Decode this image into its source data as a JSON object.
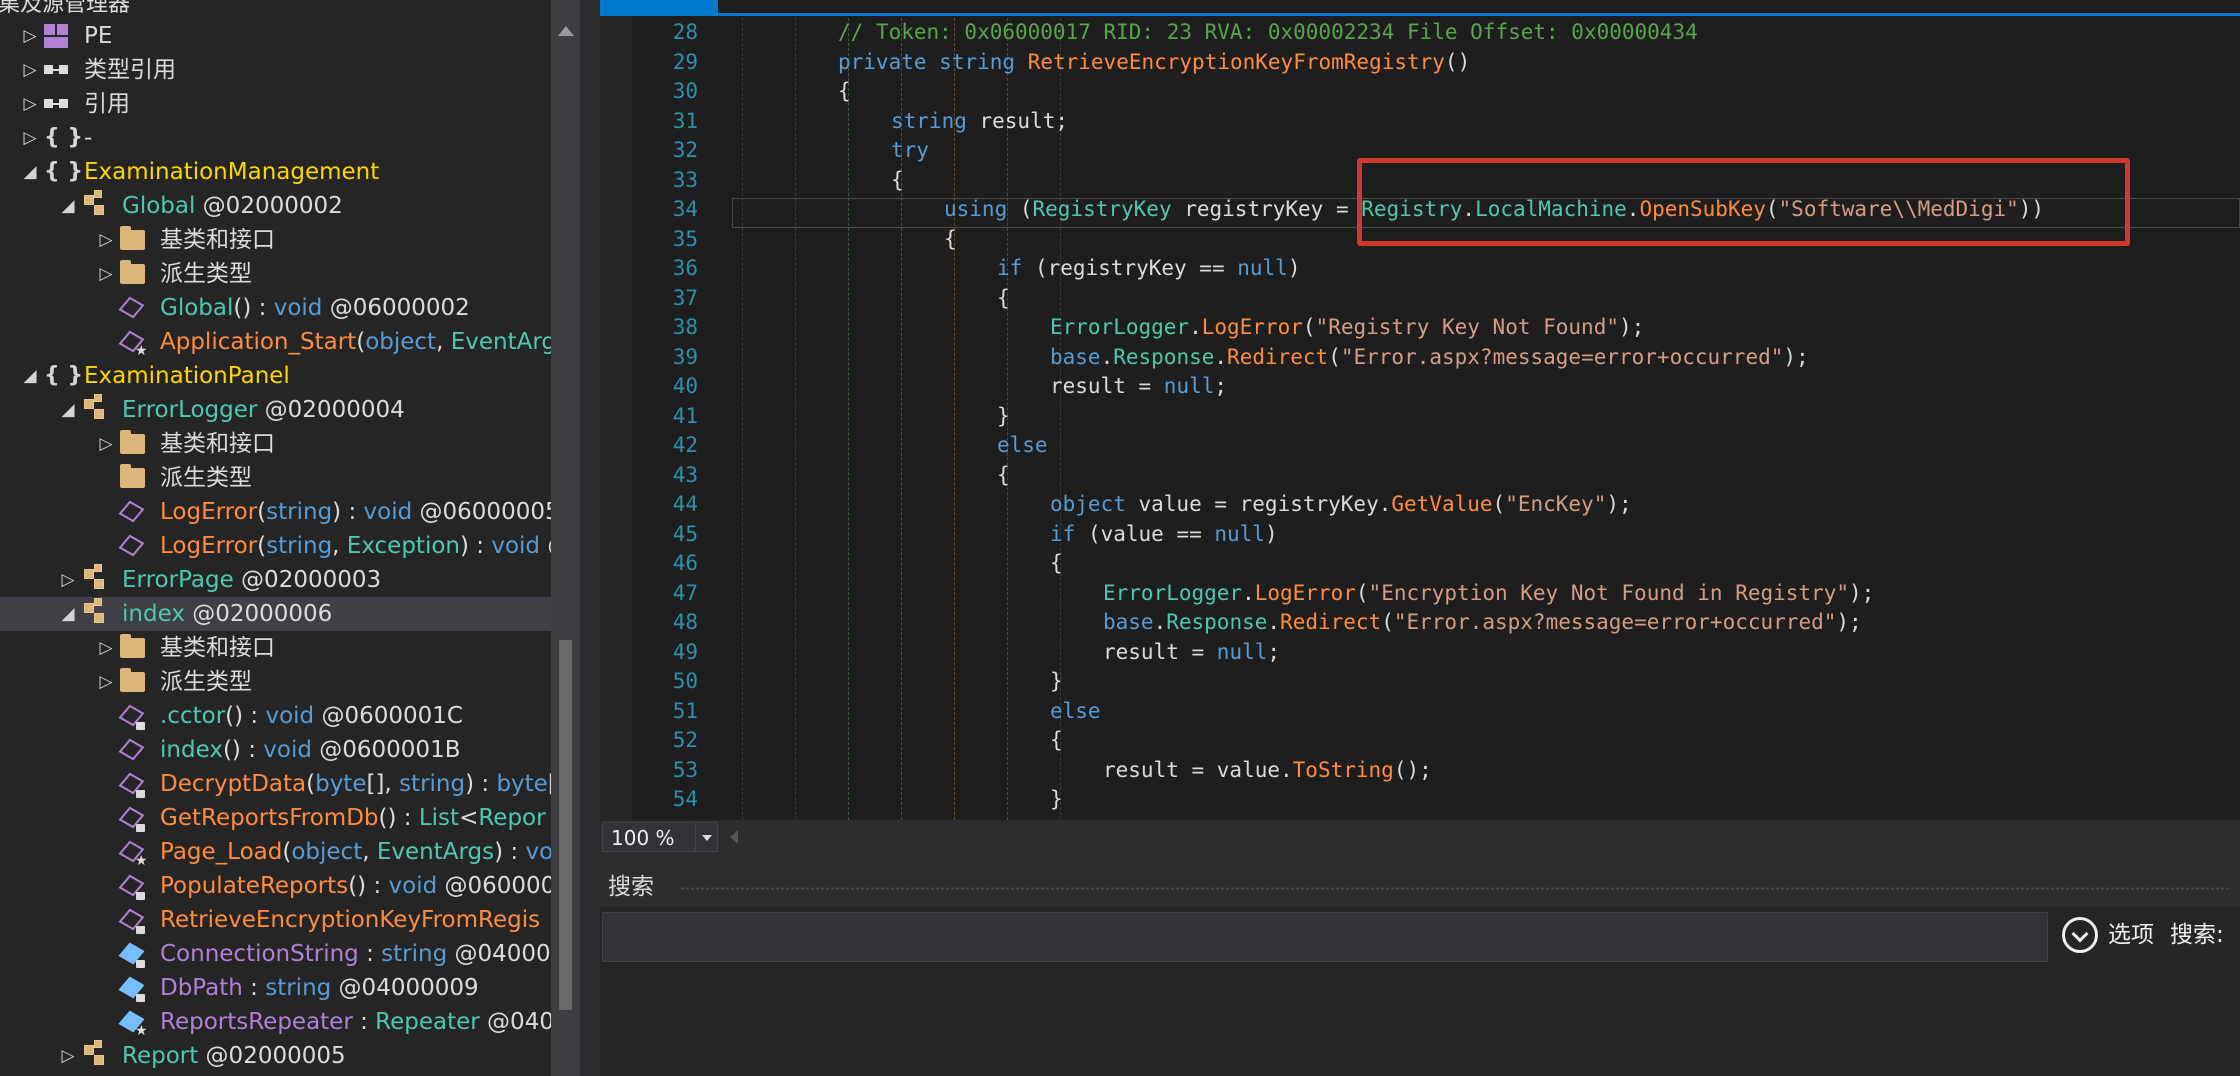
{
  "tree": {
    "title": "集及源管理器",
    "items": [
      {
        "type": "pe",
        "expander": "collapsed",
        "parts": [
          {
            "t": "PE",
            "c": "#dcdcdc"
          }
        ]
      },
      {
        "type": "ref",
        "expander": "collapsed",
        "parts": [
          {
            "t": "类型引用",
            "c": "#dcdcdc"
          }
        ]
      },
      {
        "type": "ref",
        "expander": "collapsed",
        "parts": [
          {
            "t": "引用",
            "c": "#dcdcdc"
          }
        ]
      },
      {
        "type": "ns",
        "expander": "collapsed",
        "parts": [
          {
            "t": "-",
            "c": "#dcdcdc"
          }
        ]
      },
      {
        "type": "ns",
        "expander": "expanded",
        "parts": [
          {
            "t": "ExaminationManagement",
            "c": "#ffd700"
          }
        ]
      },
      {
        "type": "class",
        "expander": "expanded",
        "parts": [
          {
            "t": "Global",
            "c": "#4ec9b0"
          },
          {
            "t": " @02000002",
            "c": "#dcdcdc"
          }
        ]
      },
      {
        "type": "folder",
        "expander": "collapsed",
        "parts": [
          {
            "t": "基类和接口",
            "c": "#dcdcdc"
          }
        ]
      },
      {
        "type": "folder",
        "expander": "collapsed",
        "parts": [
          {
            "t": "派生类型",
            "c": "#dcdcdc"
          }
        ]
      },
      {
        "type": "method",
        "expander": "none",
        "parts": [
          {
            "t": "Global",
            "c": "#4ec9b0"
          },
          {
            "t": "() : ",
            "c": "#dcdcdc"
          },
          {
            "t": "void",
            "c": "#569cd6"
          },
          {
            "t": " @06000002",
            "c": "#dcdcdc"
          }
        ]
      },
      {
        "type": "method-star",
        "expander": "none",
        "parts": [
          {
            "t": "Application_Start",
            "c": "#ff8c3f"
          },
          {
            "t": "(",
            "c": "#dcdcdc"
          },
          {
            "t": "object",
            "c": "#569cd6"
          },
          {
            "t": ", ",
            "c": "#dcdcdc"
          },
          {
            "t": "EventArgs",
            "c": "#4ec9b0"
          }
        ]
      },
      {
        "type": "ns",
        "expander": "expanded",
        "parts": [
          {
            "t": "ExaminationPanel",
            "c": "#ffd700"
          }
        ]
      },
      {
        "type": "class",
        "expander": "expanded",
        "parts": [
          {
            "t": "ErrorLogger",
            "c": "#4ec9b0"
          },
          {
            "t": " @02000004",
            "c": "#dcdcdc"
          }
        ]
      },
      {
        "type": "folder",
        "expander": "collapsed",
        "parts": [
          {
            "t": "基类和接口",
            "c": "#dcdcdc"
          }
        ]
      },
      {
        "type": "folder",
        "expander": "none",
        "parts": [
          {
            "t": "派生类型",
            "c": "#dcdcdc"
          }
        ]
      },
      {
        "type": "method",
        "expander": "none",
        "parts": [
          {
            "t": "LogError",
            "c": "#ff8c3f"
          },
          {
            "t": "(",
            "c": "#dcdcdc"
          },
          {
            "t": "string",
            "c": "#569cd6"
          },
          {
            "t": ") : ",
            "c": "#dcdcdc"
          },
          {
            "t": "void",
            "c": "#569cd6"
          },
          {
            "t": " @06000005",
            "c": "#dcdcdc"
          }
        ]
      },
      {
        "type": "method",
        "expander": "none",
        "parts": [
          {
            "t": "LogError",
            "c": "#ff8c3f"
          },
          {
            "t": "(",
            "c": "#dcdcdc"
          },
          {
            "t": "string",
            "c": "#569cd6"
          },
          {
            "t": ", ",
            "c": "#dcdcdc"
          },
          {
            "t": "Exception",
            "c": "#4ec9b0"
          },
          {
            "t": ") : ",
            "c": "#dcdcdc"
          },
          {
            "t": "void",
            "c": "#569cd6"
          },
          {
            "t": " @",
            "c": "#dcdcdc"
          }
        ]
      },
      {
        "type": "class",
        "expander": "collapsed",
        "parts": [
          {
            "t": "ErrorPage",
            "c": "#4ec9b0"
          },
          {
            "t": " @02000003",
            "c": "#dcdcdc"
          }
        ]
      },
      {
        "type": "class",
        "expander": "expanded",
        "selected": true,
        "parts": [
          {
            "t": "index",
            "c": "#4ec9b0"
          },
          {
            "t": " @02000006",
            "c": "#dcdcdc"
          }
        ]
      },
      {
        "type": "folder",
        "expander": "collapsed",
        "parts": [
          {
            "t": "基类和接口",
            "c": "#dcdcdc"
          }
        ]
      },
      {
        "type": "folder",
        "expander": "collapsed",
        "parts": [
          {
            "t": "派生类型",
            "c": "#dcdcdc"
          }
        ]
      },
      {
        "type": "method-lock",
        "expander": "none",
        "parts": [
          {
            "t": ".cctor",
            "c": "#4ec9b0"
          },
          {
            "t": "() : ",
            "c": "#dcdcdc"
          },
          {
            "t": "void",
            "c": "#569cd6"
          },
          {
            "t": " @0600001C",
            "c": "#dcdcdc"
          }
        ]
      },
      {
        "type": "method",
        "expander": "none",
        "parts": [
          {
            "t": "index",
            "c": "#4ec9b0"
          },
          {
            "t": "() : ",
            "c": "#dcdcdc"
          },
          {
            "t": "void",
            "c": "#569cd6"
          },
          {
            "t": " @0600001B",
            "c": "#dcdcdc"
          }
        ]
      },
      {
        "type": "method-lock",
        "expander": "none",
        "parts": [
          {
            "t": "DecryptData",
            "c": "#ff8c3f"
          },
          {
            "t": "(",
            "c": "#dcdcdc"
          },
          {
            "t": "byte",
            "c": "#569cd6"
          },
          {
            "t": "[], ",
            "c": "#dcdcdc"
          },
          {
            "t": "string",
            "c": "#569cd6"
          },
          {
            "t": ") : ",
            "c": "#dcdcdc"
          },
          {
            "t": "byte",
            "c": "#569cd6"
          },
          {
            "t": "[",
            "c": "#dcdcdc"
          }
        ]
      },
      {
        "type": "method-lock",
        "expander": "none",
        "parts": [
          {
            "t": "GetReportsFromDb",
            "c": "#ff8c3f"
          },
          {
            "t": "() : ",
            "c": "#dcdcdc"
          },
          {
            "t": "List",
            "c": "#4ec9b0"
          },
          {
            "t": "<",
            "c": "#dcdcdc"
          },
          {
            "t": "Repor",
            "c": "#4ec9b0"
          }
        ]
      },
      {
        "type": "method-star",
        "expander": "none",
        "parts": [
          {
            "t": "Page_Load",
            "c": "#ff8c3f"
          },
          {
            "t": "(",
            "c": "#dcdcdc"
          },
          {
            "t": "object",
            "c": "#569cd6"
          },
          {
            "t": ", ",
            "c": "#dcdcdc"
          },
          {
            "t": "EventArgs",
            "c": "#4ec9b0"
          },
          {
            "t": ") : ",
            "c": "#dcdcdc"
          },
          {
            "t": "vo",
            "c": "#569cd6"
          }
        ]
      },
      {
        "type": "method-lock",
        "expander": "none",
        "parts": [
          {
            "t": "PopulateReports",
            "c": "#ff8c3f"
          },
          {
            "t": "() : ",
            "c": "#dcdcdc"
          },
          {
            "t": "void",
            "c": "#569cd6"
          },
          {
            "t": " @060000",
            "c": "#dcdcdc"
          }
        ]
      },
      {
        "type": "method-lock",
        "expander": "none",
        "parts": [
          {
            "t": "RetrieveEncryptionKeyFromRegis",
            "c": "#ff8c3f"
          }
        ]
      },
      {
        "type": "field-lock",
        "expander": "none",
        "parts": [
          {
            "t": "ConnectionString",
            "c": "#b180d7"
          },
          {
            "t": " : ",
            "c": "#dcdcdc"
          },
          {
            "t": "string",
            "c": "#569cd6"
          },
          {
            "t": " @04000",
            "c": "#dcdcdc"
          }
        ]
      },
      {
        "type": "field-lock",
        "expander": "none",
        "parts": [
          {
            "t": "DbPath",
            "c": "#b180d7"
          },
          {
            "t": " : ",
            "c": "#dcdcdc"
          },
          {
            "t": "string",
            "c": "#569cd6"
          },
          {
            "t": " @04000009",
            "c": "#dcdcdc"
          }
        ]
      },
      {
        "type": "field-star",
        "expander": "none",
        "parts": [
          {
            "t": "ReportsRepeater",
            "c": "#b180d7"
          },
          {
            "t": " : ",
            "c": "#dcdcdc"
          },
          {
            "t": "Repeater",
            "c": "#4ec9b0"
          },
          {
            "t": " @040",
            "c": "#dcdcdc"
          }
        ]
      },
      {
        "type": "class",
        "expander": "collapsed",
        "parts": [
          {
            "t": "Report",
            "c": "#4ec9b0"
          },
          {
            "t": " @02000005",
            "c": "#dcdcdc"
          }
        ]
      }
    ]
  },
  "code": {
    "lines": [
      {
        "n": "28",
        "t": [
          [
            "cm",
            "// Token: 0x06000017 RID: 23 RVA: 0x00002234 File Offset: 0x00000434"
          ]
        ],
        "ind": 4
      },
      {
        "n": "29",
        "t": [
          [
            "kw",
            "private"
          ],
          [
            "pl",
            " "
          ],
          [
            "kw",
            "string"
          ],
          [
            "pl",
            " "
          ],
          [
            "mt",
            "RetrieveEncryptionKeyFromRegistry"
          ],
          [
            "pl",
            "()"
          ]
        ],
        "ind": 4
      },
      {
        "n": "30",
        "t": [
          [
            "pl",
            "{"
          ]
        ],
        "ind": 4
      },
      {
        "n": "31",
        "t": [
          [
            "kw",
            "string"
          ],
          [
            "pl",
            " result;"
          ]
        ],
        "ind": 5
      },
      {
        "n": "32",
        "t": [
          [
            "kw",
            "try"
          ]
        ],
        "ind": 5
      },
      {
        "n": "33",
        "t": [
          [
            "pl",
            "{"
          ]
        ],
        "ind": 5
      },
      {
        "n": "34",
        "t": [
          [
            "kw",
            "using"
          ],
          [
            "pl",
            " ("
          ],
          [
            "ty",
            "RegistryKey"
          ],
          [
            "pl",
            " registryKey = "
          ],
          [
            "ty",
            "Registry"
          ],
          [
            "pl",
            "."
          ],
          [
            "ty",
            "LocalMachine"
          ],
          [
            "pl",
            "."
          ],
          [
            "mt",
            "OpenSubKey"
          ],
          [
            "pl",
            "("
          ],
          [
            "st",
            "\"Software\\\\MedDigi\""
          ],
          [
            "pl",
            "))"
          ]
        ],
        "ind": 6
      },
      {
        "n": "35",
        "t": [
          [
            "pl",
            "{"
          ]
        ],
        "ind": 6
      },
      {
        "n": "36",
        "t": [
          [
            "kw",
            "if"
          ],
          [
            "pl",
            " (registryKey == "
          ],
          [
            "kw",
            "null"
          ],
          [
            "pl",
            ")"
          ]
        ],
        "ind": 7
      },
      {
        "n": "37",
        "t": [
          [
            "pl",
            "{"
          ]
        ],
        "ind": 7
      },
      {
        "n": "38",
        "t": [
          [
            "ty",
            "ErrorLogger"
          ],
          [
            "pl",
            "."
          ],
          [
            "mt",
            "LogError"
          ],
          [
            "pl",
            "("
          ],
          [
            "st",
            "\"Registry Key Not Found\""
          ],
          [
            "pl",
            ");"
          ]
        ],
        "ind": 8
      },
      {
        "n": "39",
        "t": [
          [
            "kw",
            "base"
          ],
          [
            "pl",
            "."
          ],
          [
            "ty",
            "Response"
          ],
          [
            "pl",
            "."
          ],
          [
            "mt",
            "Redirect"
          ],
          [
            "pl",
            "("
          ],
          [
            "st",
            "\"Error.aspx?message=error+occurred\""
          ],
          [
            "pl",
            ");"
          ]
        ],
        "ind": 8
      },
      {
        "n": "40",
        "t": [
          [
            "pl",
            "result = "
          ],
          [
            "kw",
            "null"
          ],
          [
            "pl",
            ";"
          ]
        ],
        "ind": 8
      },
      {
        "n": "41",
        "t": [
          [
            "pl",
            "}"
          ]
        ],
        "ind": 7
      },
      {
        "n": "42",
        "t": [
          [
            "kw",
            "else"
          ]
        ],
        "ind": 7
      },
      {
        "n": "43",
        "t": [
          [
            "pl",
            "{"
          ]
        ],
        "ind": 7
      },
      {
        "n": "44",
        "t": [
          [
            "kw",
            "object"
          ],
          [
            "pl",
            " value = registryKey."
          ],
          [
            "mt",
            "GetValue"
          ],
          [
            "pl",
            "("
          ],
          [
            "st",
            "\"EncKey\""
          ],
          [
            "pl",
            ");"
          ]
        ],
        "ind": 8
      },
      {
        "n": "45",
        "t": [
          [
            "kw",
            "if"
          ],
          [
            "pl",
            " (value == "
          ],
          [
            "kw",
            "null"
          ],
          [
            "pl",
            ")"
          ]
        ],
        "ind": 8
      },
      {
        "n": "46",
        "t": [
          [
            "pl",
            "{"
          ]
        ],
        "ind": 8
      },
      {
        "n": "47",
        "t": [
          [
            "ty",
            "ErrorLogger"
          ],
          [
            "pl",
            "."
          ],
          [
            "mt",
            "LogError"
          ],
          [
            "pl",
            "("
          ],
          [
            "st",
            "\"Encryption Key Not Found in Registry\""
          ],
          [
            "pl",
            ");"
          ]
        ],
        "ind": 9
      },
      {
        "n": "48",
        "t": [
          [
            "kw",
            "base"
          ],
          [
            "pl",
            "."
          ],
          [
            "ty",
            "Response"
          ],
          [
            "pl",
            "."
          ],
          [
            "mt",
            "Redirect"
          ],
          [
            "pl",
            "("
          ],
          [
            "st",
            "\"Error.aspx?message=error+occurred\""
          ],
          [
            "pl",
            ");"
          ]
        ],
        "ind": 9
      },
      {
        "n": "49",
        "t": [
          [
            "pl",
            "result = "
          ],
          [
            "kw",
            "null"
          ],
          [
            "pl",
            ";"
          ]
        ],
        "ind": 9
      },
      {
        "n": "50",
        "t": [
          [
            "pl",
            "}"
          ]
        ],
        "ind": 8
      },
      {
        "n": "51",
        "t": [
          [
            "kw",
            "else"
          ]
        ],
        "ind": 8
      },
      {
        "n": "52",
        "t": [
          [
            "pl",
            "{"
          ]
        ],
        "ind": 8
      },
      {
        "n": "53",
        "t": [
          [
            "pl",
            "result = value."
          ],
          [
            "mt",
            "ToString"
          ],
          [
            "pl",
            "();"
          ]
        ],
        "ind": 9
      },
      {
        "n": "54",
        "t": [
          [
            "pl",
            "}"
          ]
        ],
        "ind": 8
      }
    ]
  },
  "zoom": {
    "value": "100 %"
  },
  "search": {
    "title": "搜索",
    "options_label": "选项",
    "search_label": "搜索:",
    "input_value": ""
  },
  "colors": {
    "accent": "#007acc",
    "highlight_box": "#d03a2c"
  }
}
